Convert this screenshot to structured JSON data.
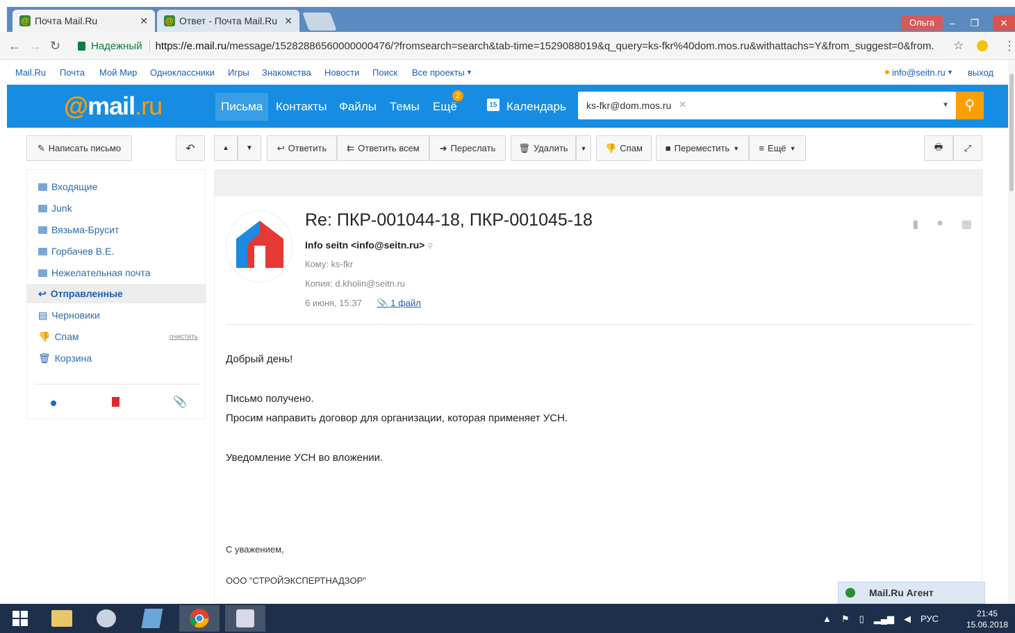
{
  "browser": {
    "tabs": [
      {
        "label": "Почта Mail.Ru"
      },
      {
        "label": "Ответ - Почта Mail.Ru"
      }
    ],
    "user": "Ольга",
    "secure_label": "Надежный",
    "url_domain": "https://e.mail.ru",
    "url_rest": "/message/15282886560000000476/?fromsearch=search&tab-time=1529088019&q_query=ks-fkr%40dom.mos.ru&withattachs=Y&from_suggest=0&from..."
  },
  "portal": {
    "links": [
      "Mail.Ru",
      "Почта",
      "Мой Мир",
      "Одноклассники",
      "Игры",
      "Знакомства",
      "Новости",
      "Поиск",
      "Все проекты"
    ],
    "account": "info@seitn.ru",
    "logout": "выход"
  },
  "header": {
    "logo_at": "@",
    "logo_mail": "mail",
    "logo_ru": ".ru",
    "nav": [
      "Письма",
      "Контакты",
      "Файлы",
      "Темы",
      "Ещё"
    ],
    "more_badge": "2",
    "calendar_icon_day": "15",
    "calendar": "Календарь",
    "search_tag": "ks-fkr@dom.mos.ru"
  },
  "toolbar": {
    "compose": "Написать письмо",
    "reply": "Ответить",
    "reply_all": "Ответить всем",
    "forward": "Переслать",
    "delete": "Удалить",
    "spam": "Спам",
    "move": "Переместить",
    "more": "Ещё"
  },
  "sidebar": {
    "folders": [
      {
        "label": "Входящие"
      },
      {
        "label": "Junk"
      },
      {
        "label": "Вязьма-Брусит"
      },
      {
        "label": "Горбачев В.Е."
      },
      {
        "label": "Нежелательная почта"
      },
      {
        "label": "Отправленные"
      },
      {
        "label": "Черновики"
      },
      {
        "label": "Спам"
      },
      {
        "label": "Корзина"
      }
    ],
    "clear": "очистить"
  },
  "message": {
    "subject": "Re: ПКР-001044-18, ПКР-001045-18",
    "from": "Info seitn <info@seitn.ru>",
    "to": "Кому: ks-fkr",
    "cc": "Копия: d.kholin@seitn.ru",
    "date": "6 июня, 15:37",
    "attachments": "1 файл",
    "body": [
      "Добрый день!",
      "Письмо получено.",
      "Просим направить договор для организации, которая применяет УСН.",
      "Уведомление УСН во вложении."
    ],
    "signature": [
      "С уважением,",
      "ООО \"СТРОЙЭКСПЕРТНАДЗОР\""
    ]
  },
  "agent": "Mail.Ru Агент",
  "taskbar": {
    "lang": "РУС",
    "time": "21:45",
    "date": "15.06.2018"
  }
}
